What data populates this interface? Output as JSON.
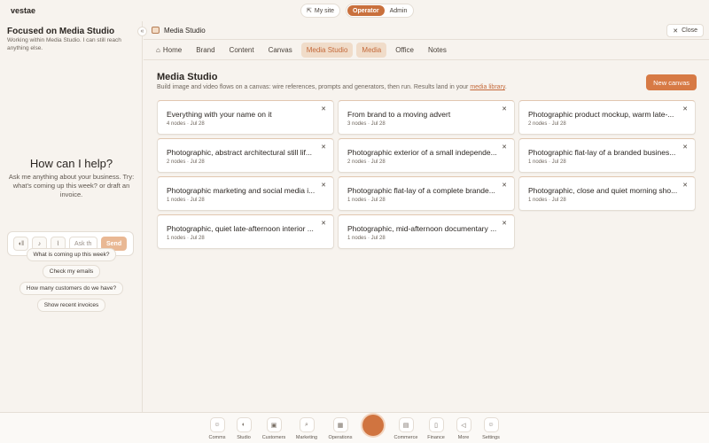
{
  "app": {
    "brand": "vestae"
  },
  "mode": {
    "my_site": "My site",
    "options": [
      "Operator",
      "Admin"
    ],
    "active": "Operator"
  },
  "sidebar": {
    "title": "Focused on Media Studio",
    "subtitle": "Working within Media Studio. I can still reach anything else.",
    "collapse_glyph": "«",
    "help_title": "How can I help?",
    "help_text": "Ask me anything about your business. Try: what's coming up this week? or draft an invoice.",
    "composer": {
      "placeholder": "Ask th",
      "send_label": "Send"
    },
    "suggestions": [
      "What is coming up this week?",
      "Check my emails",
      "How many customers do we have?",
      "Show recent invoices"
    ]
  },
  "window": {
    "title": "Media Studio",
    "close_label": "Close"
  },
  "tabs": [
    {
      "label": "Home"
    },
    {
      "label": "Brand"
    },
    {
      "label": "Content"
    },
    {
      "label": "Canvas"
    },
    {
      "label": "Media Studio"
    },
    {
      "label": "Media"
    },
    {
      "label": "Office"
    },
    {
      "label": "Notes"
    }
  ],
  "media_studio": {
    "title": "Media Studio",
    "description": "Build image and video flows on a canvas: wire references, prompts and generators, then run. Results land in your",
    "link_text": "media library",
    "new_canvas_label": "New canvas",
    "cards": [
      {
        "title": "Everything with your name on it",
        "meta": "4 nodes · Jul 28"
      },
      {
        "title": "From brand to a moving advert",
        "meta": "3 nodes · Jul 28"
      },
      {
        "title": "Photographic product mockup, warm late-...",
        "meta": "2 nodes · Jul 28"
      },
      {
        "title": "Photographic, abstract architectural still lif...",
        "meta": "2 nodes · Jul 28"
      },
      {
        "title": "Photographic exterior of a small independe...",
        "meta": "2 nodes · Jul 28"
      },
      {
        "title": "Photographic flat-lay of a branded busines...",
        "meta": "1 nodes · Jul 28"
      },
      {
        "title": "Photographic marketing and social media i...",
        "meta": "1 nodes · Jul 28"
      },
      {
        "title": "Photographic flat-lay of a complete brande...",
        "meta": "1 nodes · Jul 28"
      },
      {
        "title": "Photographic, close and quiet morning sho...",
        "meta": "1 nodes · Jul 28"
      },
      {
        "title": "Photographic, quiet late-afternoon interior ...",
        "meta": "1 nodes · Jul 28"
      },
      {
        "title": "Photographic, mid-afternoon documentary ...",
        "meta": "1 nodes · Jul 28"
      }
    ]
  },
  "dock": {
    "items": [
      {
        "label": "Comms",
        "icon": "people-icon",
        "glyph": "☺"
      },
      {
        "label": "Studio",
        "icon": "palette-icon",
        "glyph": "◐"
      },
      {
        "label": "Customers",
        "icon": "contacts-icon",
        "glyph": "▣"
      },
      {
        "label": "Marketing",
        "icon": "search-icon",
        "glyph": "⌕"
      },
      {
        "label": "Operations",
        "icon": "calendar-icon",
        "glyph": "▦"
      },
      {
        "label": "Commerce",
        "icon": "store-icon",
        "glyph": "▤"
      },
      {
        "label": "Finance",
        "icon": "document-icon",
        "glyph": "▯"
      },
      {
        "label": "More",
        "icon": "megaphone-icon",
        "glyph": "◁"
      },
      {
        "label": "Settings",
        "icon": "settings-people-icon",
        "glyph": "☺"
      }
    ]
  },
  "colors": {
    "accent": "#d77a45",
    "background": "#f7f3ee",
    "tab_active_bg": "#f0dcc9"
  }
}
